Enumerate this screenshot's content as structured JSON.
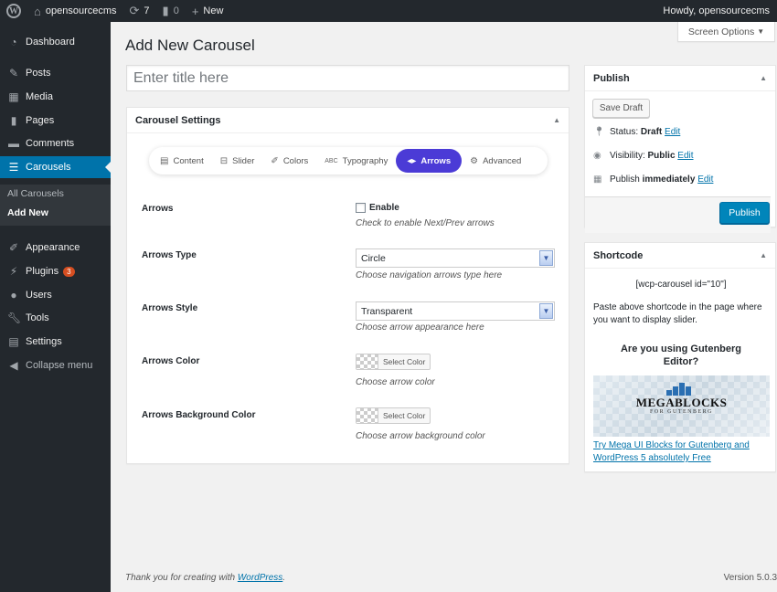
{
  "adminbar": {
    "site_name": "opensourcecms",
    "updates_count": "7",
    "comments_count": "0",
    "new_label": "New",
    "howdy": "Howdy, opensourcecms"
  },
  "sidebar": {
    "items": [
      {
        "label": "Dashboard",
        "icon": "dashboard-icon"
      },
      {
        "label": "Posts",
        "icon": "pin-icon"
      },
      {
        "label": "Media",
        "icon": "media-icon"
      },
      {
        "label": "Pages",
        "icon": "pages-icon"
      },
      {
        "label": "Comments",
        "icon": "comment-icon"
      },
      {
        "label": "Carousels",
        "icon": "list-icon"
      },
      {
        "label": "Appearance",
        "icon": "brush-icon"
      },
      {
        "label": "Plugins",
        "icon": "plug-icon",
        "badge": "3"
      },
      {
        "label": "Users",
        "icon": "user-icon"
      },
      {
        "label": "Tools",
        "icon": "wrench-icon"
      },
      {
        "label": "Settings",
        "icon": "settings-icon"
      },
      {
        "label": "Collapse menu",
        "icon": "collapse-icon"
      }
    ],
    "submenu": [
      "All Carousels",
      "Add New"
    ]
  },
  "screen_options": "Screen Options",
  "page_title": "Add New Carousel",
  "title_placeholder": "Enter title here",
  "carousel_settings": {
    "title": "Carousel Settings",
    "tabs": [
      {
        "label": "Content",
        "icon": "document-icon"
      },
      {
        "label": "Slider",
        "icon": "slider-icon"
      },
      {
        "label": "Colors",
        "icon": "brush-icon"
      },
      {
        "label": "Typography",
        "icon": "typography-icon"
      },
      {
        "label": "Arrows",
        "icon": "arrows-icon",
        "active": true
      },
      {
        "label": "Advanced",
        "icon": "gear-icon"
      }
    ],
    "fields": {
      "arrows": {
        "label": "Arrows",
        "checkbox_label": "Enable",
        "desc": "Check to enable Next/Prev arrows"
      },
      "arrows_type": {
        "label": "Arrows Type",
        "value": "Circle",
        "desc": "Choose navigation arrows type here"
      },
      "arrows_style": {
        "label": "Arrows Style",
        "value": "Transparent",
        "desc": "Choose arrow appearance here"
      },
      "arrows_color": {
        "label": "Arrows Color",
        "button": "Select Color",
        "desc": "Choose arrow color"
      },
      "arrows_bg_color": {
        "label": "Arrows Background Color",
        "button": "Select Color",
        "desc": "Choose arrow background color"
      }
    }
  },
  "publish": {
    "title": "Publish",
    "save_draft": "Save Draft",
    "status_label": "Status:",
    "status_value": "Draft",
    "visibility_label": "Visibility:",
    "visibility_value": "Public",
    "publish_label": "Publish",
    "publish_value": "immediately",
    "edit": "Edit",
    "publish_button": "Publish"
  },
  "shortcode": {
    "title": "Shortcode",
    "code": "[wcp-carousel id=\"10\"]",
    "help": "Paste above shortcode in the page where you want to display slider.",
    "gutenberg_q": "Are you using Gutenberg Editor?",
    "banner_title": "MEGABLOCKS",
    "banner_sub": "FOR GUTENBERG",
    "link": "Try Mega UI Blocks for Gutenberg and WordPress 5 absolutely Free"
  },
  "footer": {
    "thanks": "Thank you for creating with ",
    "wp_link": "WordPress",
    "thanks_end": ".",
    "version": "Version 5.0.3"
  },
  "colors": {
    "accent": "#0073aa",
    "active_tab": "#4b3bd6",
    "sidebar": "#23282d"
  }
}
